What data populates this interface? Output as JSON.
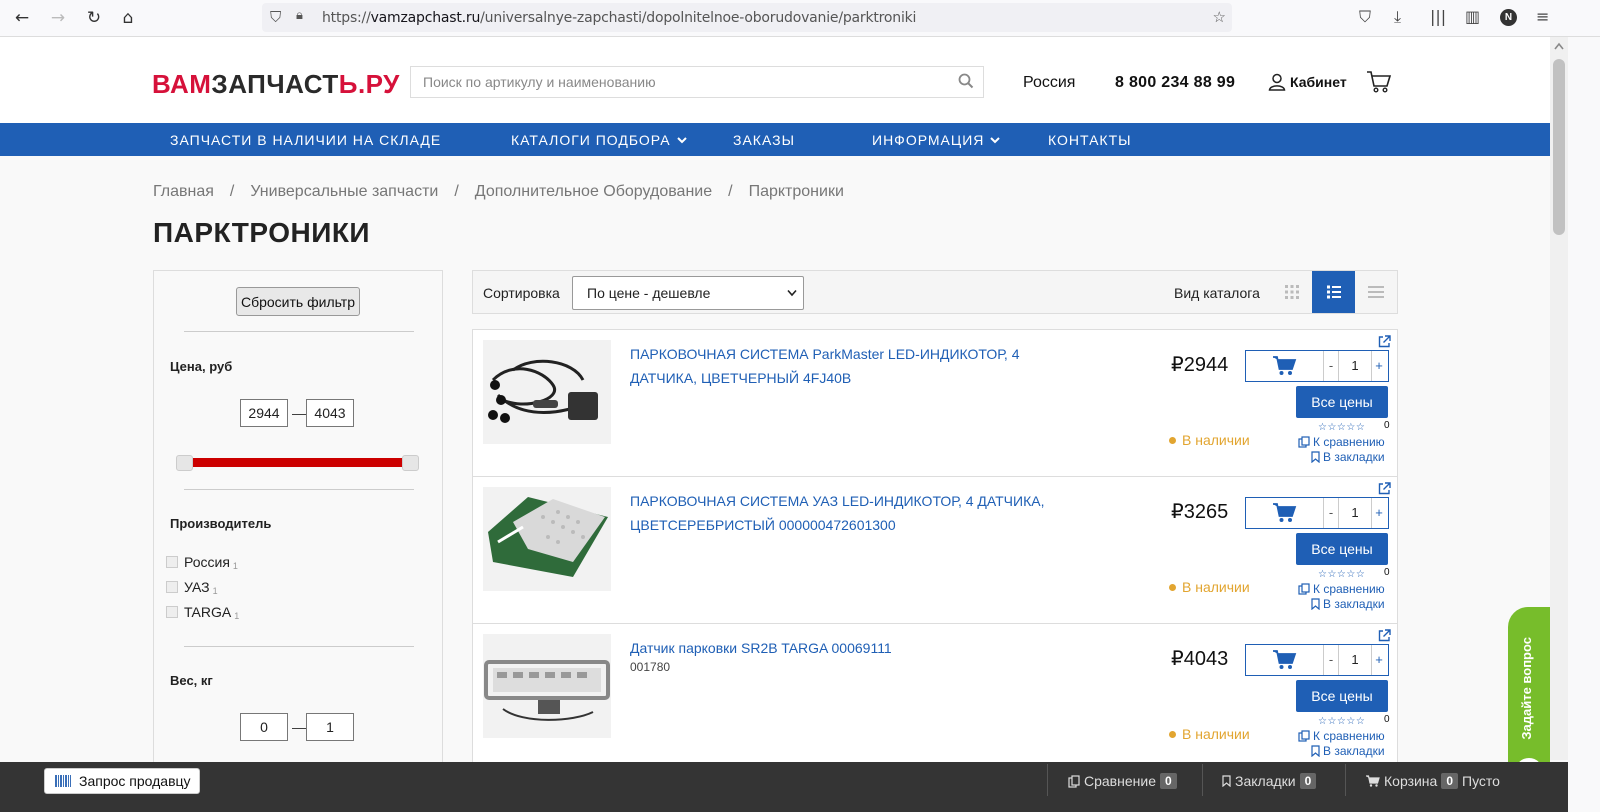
{
  "browser": {
    "url_prefix": "https://",
    "url_domain": "vamzapchast.ru",
    "url_path": "/universalnye-zapchasti/dopolnitelnoe-oborudovanie/parktroniki",
    "profile_initial": "N"
  },
  "header": {
    "logo_part1": "ВАМ",
    "logo_part2": "ЗАПЧАСТ",
    "logo_part3": "Ь.РУ",
    "search_placeholder": "Поиск по артикулу и наименованию",
    "region": "Россия",
    "phone": "8 800 234 88 99",
    "cabinet": "Кабинет"
  },
  "menu": [
    {
      "label": "Запчасти в наличии на складе"
    },
    {
      "label": "Каталоги подбора"
    },
    {
      "label": "Заказы"
    },
    {
      "label": "Информация"
    },
    {
      "label": "Контакты"
    }
  ],
  "breadcrumb": [
    "Главная",
    "Универсальные запчасти",
    "Дополнительное Оборудование",
    "Парктроники"
  ],
  "breadcrumb_sep": "/",
  "page_title": "ПАРКТРОНИКИ",
  "filters": {
    "reset_label": "Сбросить фильтр",
    "price_heading": "Цена, руб",
    "price_min": "2944",
    "price_max": "4043",
    "range_dash": "—",
    "manufacturer_heading": "Производитель",
    "manufacturers": [
      {
        "name": "Россия",
        "count": "1"
      },
      {
        "name": "УАЗ",
        "count": "1"
      },
      {
        "name": "TARGA",
        "count": "1"
      }
    ],
    "weight_heading": "Вес, кг",
    "weight_min": "0",
    "weight_max": "1"
  },
  "toolbar": {
    "sort_label": "Сортировка",
    "sort_value": "По цене - дешевле",
    "view_label": "Вид каталога"
  },
  "products": [
    {
      "title": "ПАРКОВОЧНАЯ СИСТЕМА ParkMaster LED-ИНДИКОТОР, 4 ДАТЧИКА, ЦВЕТЧЕРНЫЙ 4FJ40B",
      "sku": "",
      "price": "2944",
      "currency": "₽",
      "qty": "1",
      "stock": "В наличии",
      "rating_count": "0"
    },
    {
      "title": "ПАРКОВОЧНАЯ СИСТЕМА УАЗ LED-ИНДИКОТОР, 4 ДАТЧИКА, ЦВЕТСЕРЕБРИСТЫЙ 000000472601300",
      "sku": "",
      "price": "3265",
      "currency": "₽",
      "qty": "1",
      "stock": "В наличии",
      "rating_count": "0"
    },
    {
      "title": "Датчик парковки SR2B TARGA 00069111",
      "sku": "001780",
      "price": "4043",
      "currency": "₽",
      "qty": "1",
      "stock": "В наличии",
      "rating_count": "0"
    }
  ],
  "product_labels": {
    "all_prices": "Все цены",
    "compare": "К сравнению",
    "bookmark": "В закладки",
    "minus": "-",
    "plus": "+",
    "stars": "☆☆☆☆☆"
  },
  "ask_widget": {
    "label": "Задайте вопрос"
  },
  "bottom_bar": {
    "seller_request": "Запрос продавцу",
    "compare": "Сравнение",
    "compare_count": "0",
    "bookmarks": "Закладки",
    "bookmarks_count": "0",
    "cart": "Корзина",
    "cart_count": "0",
    "cart_status": "Пусто"
  },
  "colors": {
    "brand_red": "#d6113a",
    "menu_blue": "#1f5fb5",
    "stock_orange": "#e2a530",
    "widget_green": "#77bd2b",
    "slider_red": "#cc0000"
  }
}
